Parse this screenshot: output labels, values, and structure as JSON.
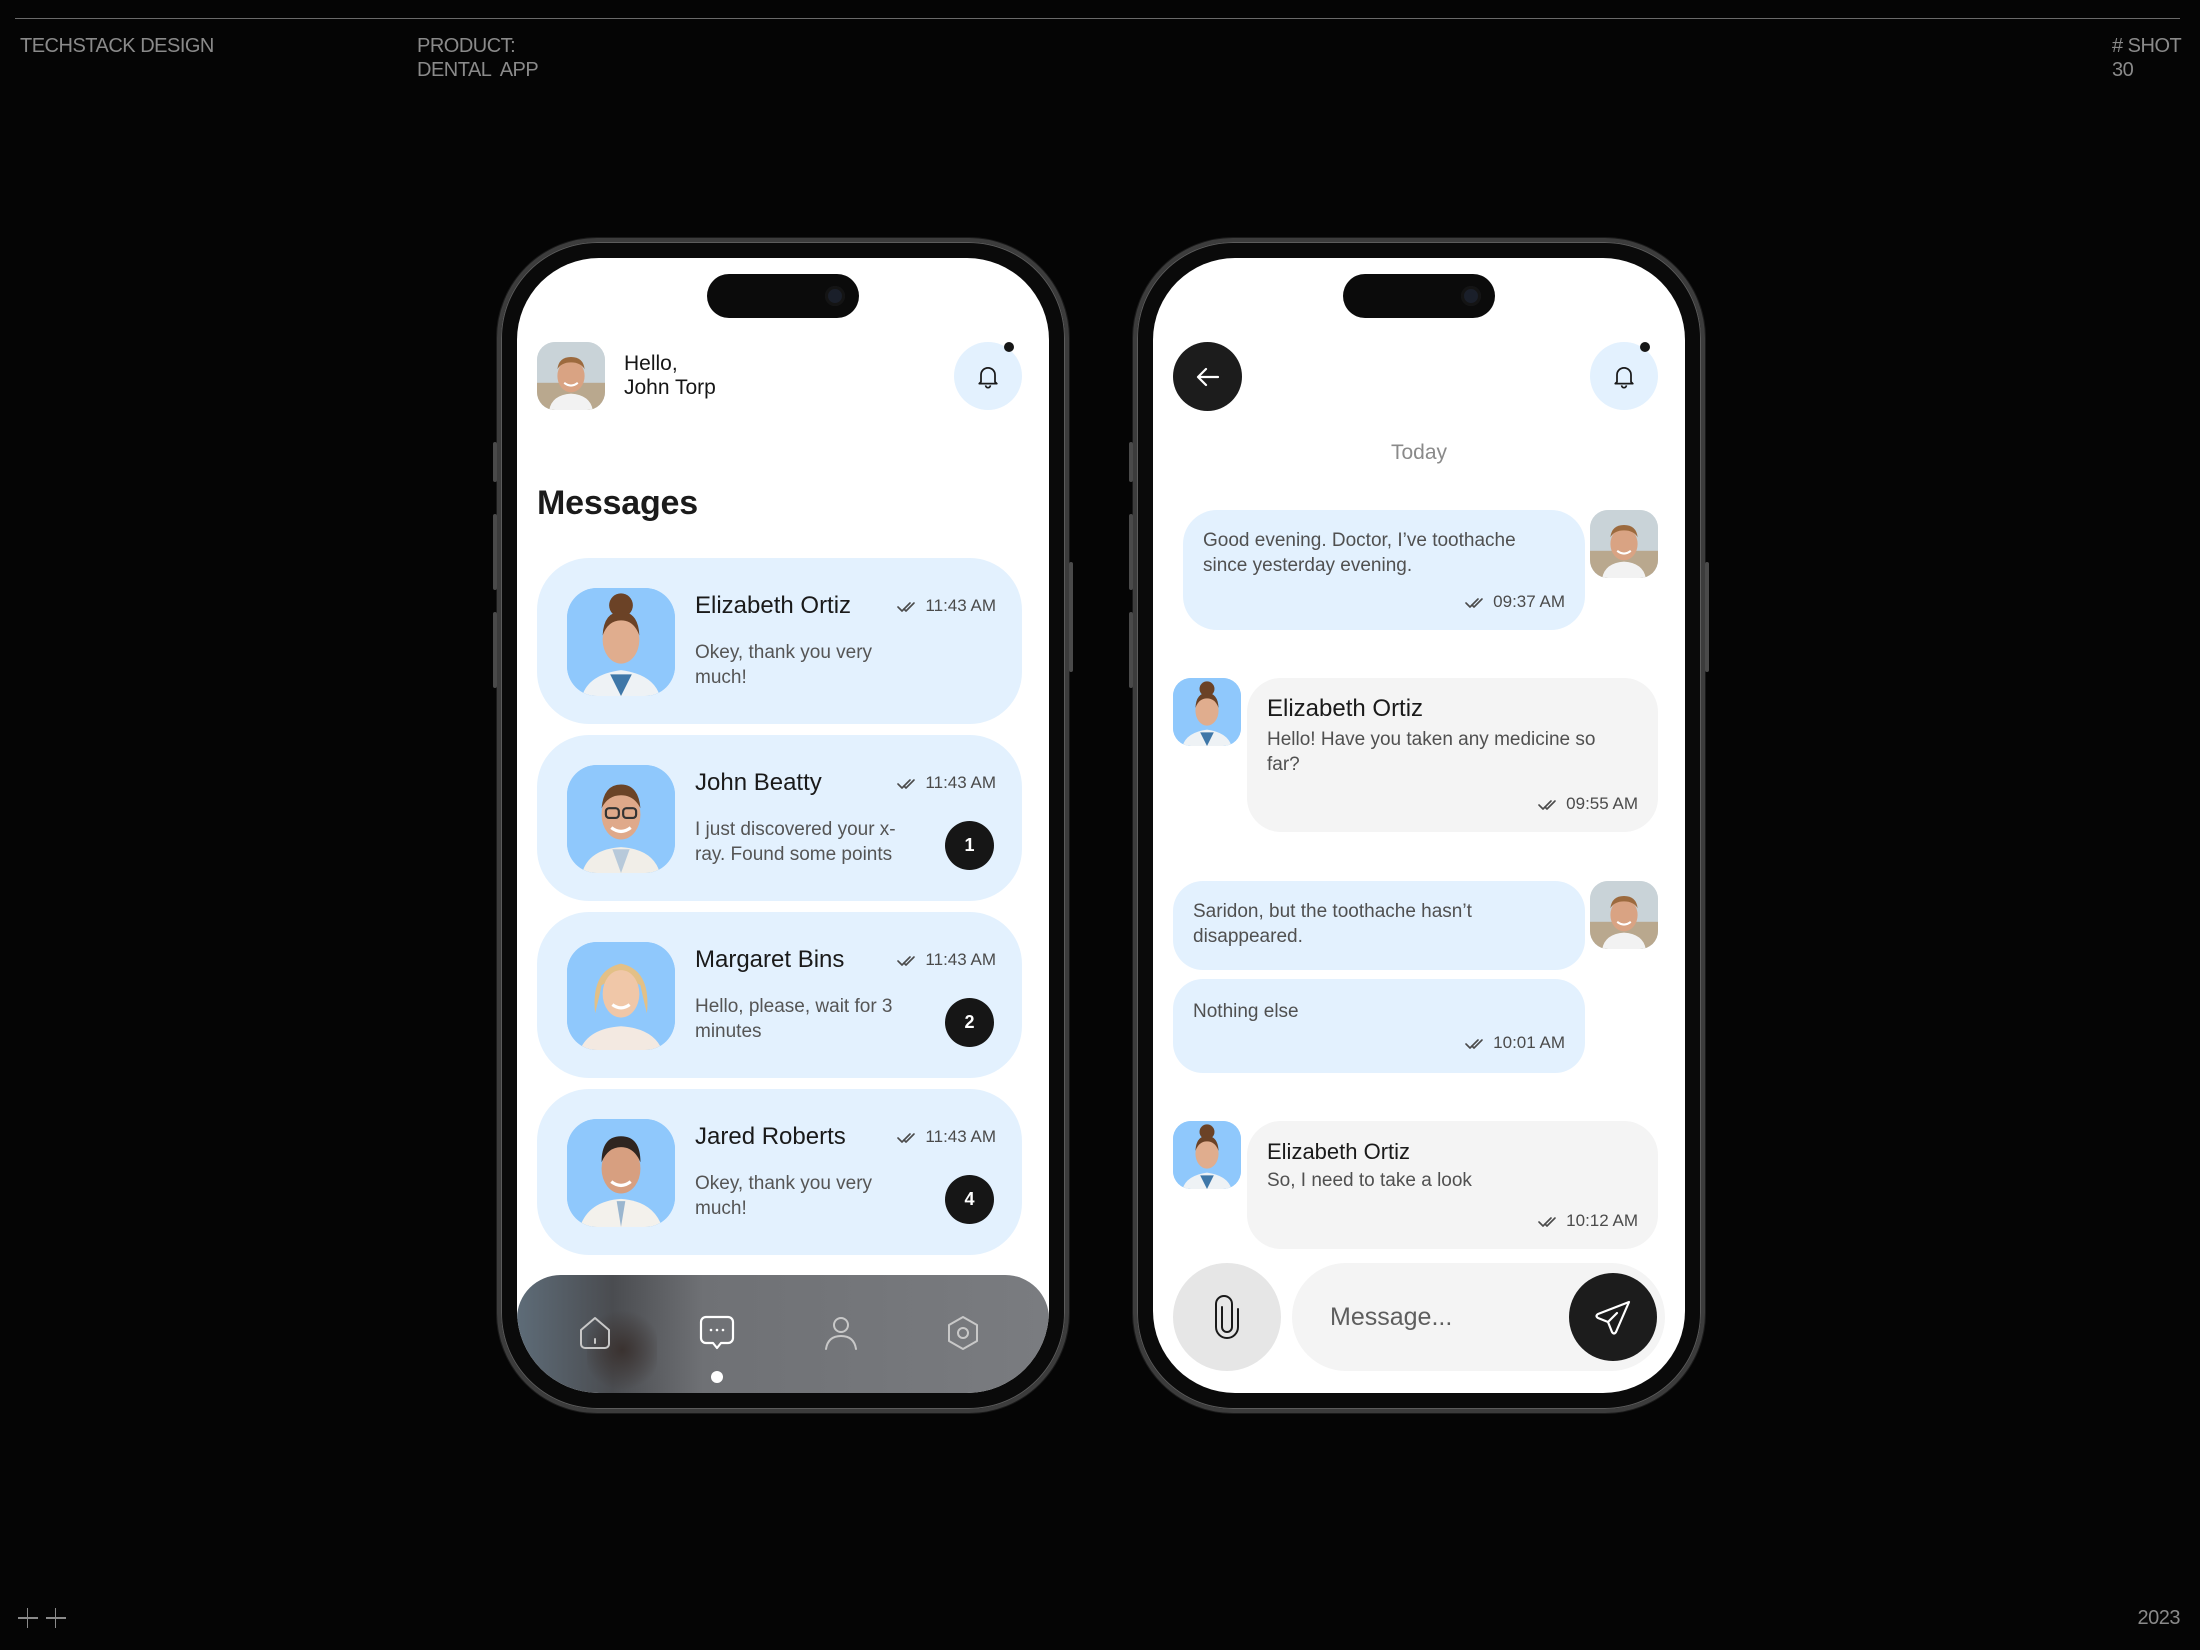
{
  "frame": {
    "studio": "TECHSTACK DESIGN",
    "product_label": "PRODUCT:",
    "product_name": "DENTAL  APP",
    "shot_label": "# SHOT",
    "shot_number": "30",
    "year": "2023"
  },
  "colors": {
    "card_bg": "#e3f1fe",
    "avatar_bg": "#8fc8fc",
    "incoming_bubble": "#f4f4f4",
    "dark": "#1c1c1c"
  },
  "messages_screen": {
    "greeting_line1": "Hello,",
    "greeting_line2": "John Torp",
    "title": "Messages",
    "notification_icon": "bell-icon",
    "chats": [
      {
        "name": "Elizabeth Ortiz",
        "time": "11:43 AM",
        "preview": "Okey, thank you very much!",
        "unread": null
      },
      {
        "name": "John Beatty",
        "time": "11:43 AM",
        "preview": "I just discovered your x-ray. Found some points",
        "unread": "1"
      },
      {
        "name": "Margaret Bins",
        "time": "11:43 AM",
        "preview": "Hello, please, wait for 3 minutes",
        "unread": "2"
      },
      {
        "name": "Jared Roberts",
        "time": "11:43 AM",
        "preview": "Okey, thank you very much!",
        "unread": "4"
      }
    ],
    "tabs": [
      {
        "id": "home",
        "icon": "home-icon"
      },
      {
        "id": "messages",
        "icon": "chat-icon",
        "active": true
      },
      {
        "id": "profile",
        "icon": "user-icon"
      },
      {
        "id": "settings",
        "icon": "settings-icon"
      }
    ]
  },
  "chat_screen": {
    "day_label": "Today",
    "messages": [
      {
        "direction": "out",
        "text": "Good evening. Doctor, I’ve toothache since yesterday evening.",
        "time": "09:37 AM"
      },
      {
        "direction": "in",
        "sender": "Elizabeth Ortiz",
        "text": "Hello! Have you taken any medicine so far?",
        "time": "09:55 AM"
      },
      {
        "direction": "out",
        "text": "Saridon, but the toothache hasn’t disappeared.",
        "time": null
      },
      {
        "direction": "out",
        "text": "Nothing else",
        "time": "10:01 AM"
      },
      {
        "direction": "in",
        "sender": "Elizabeth Ortiz",
        "text": "So, I need to take a look",
        "time": "10:12 AM"
      }
    ],
    "composer_placeholder": "Message..."
  }
}
